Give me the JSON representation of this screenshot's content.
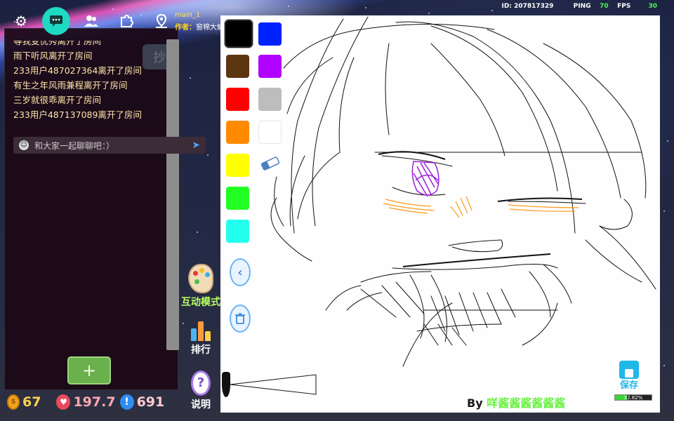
{
  "room": {
    "name": "main_1",
    "author_label": "作者：",
    "author_value": "窗棉大蚺"
  },
  "status": {
    "id": "ID: 207817329",
    "ping_label": "PING",
    "ping_value": "70",
    "fps_label": "FPS",
    "fps_value": "30"
  },
  "topbar": {
    "icons": [
      "gear-icon",
      "chat-icon",
      "people-icon",
      "puzzle-icon",
      "map-pin-icon"
    ],
    "active": "chat-icon"
  },
  "chat": {
    "lines": [
      "等我变优秀离开了房间",
      "雨下听风离开了房间",
      "233用户487027364离开了房间",
      "有生之年风雨兼程离开了房间",
      "三岁就很乖离开了房间",
      "233用户487137089离开了房间"
    ],
    "placeholder": "和大家一起聊聊吧：）",
    "ghost_button": "抄",
    "add_button": "+"
  },
  "stats": {
    "coins": "67",
    "likes": "197.7",
    "alerts": "691"
  },
  "side_tools": {
    "interact": "互动模式",
    "rank": "排行",
    "help": "说明"
  },
  "palette": {
    "colors": [
      "#000000",
      "#0022ff",
      "#5c3511",
      "#b200ff",
      "#ff0000",
      "#bdbdbd",
      "#ff8a00",
      "#ffffff",
      "#ffff00",
      "#22ff22",
      "#22ffee"
    ],
    "selected": "#000000"
  },
  "credit": {
    "prefix": "By ",
    "name": "咩酱酱酱酱酱酱"
  },
  "save": {
    "label": "保存",
    "progress_text": "32.82%",
    "progress": 32.82
  }
}
